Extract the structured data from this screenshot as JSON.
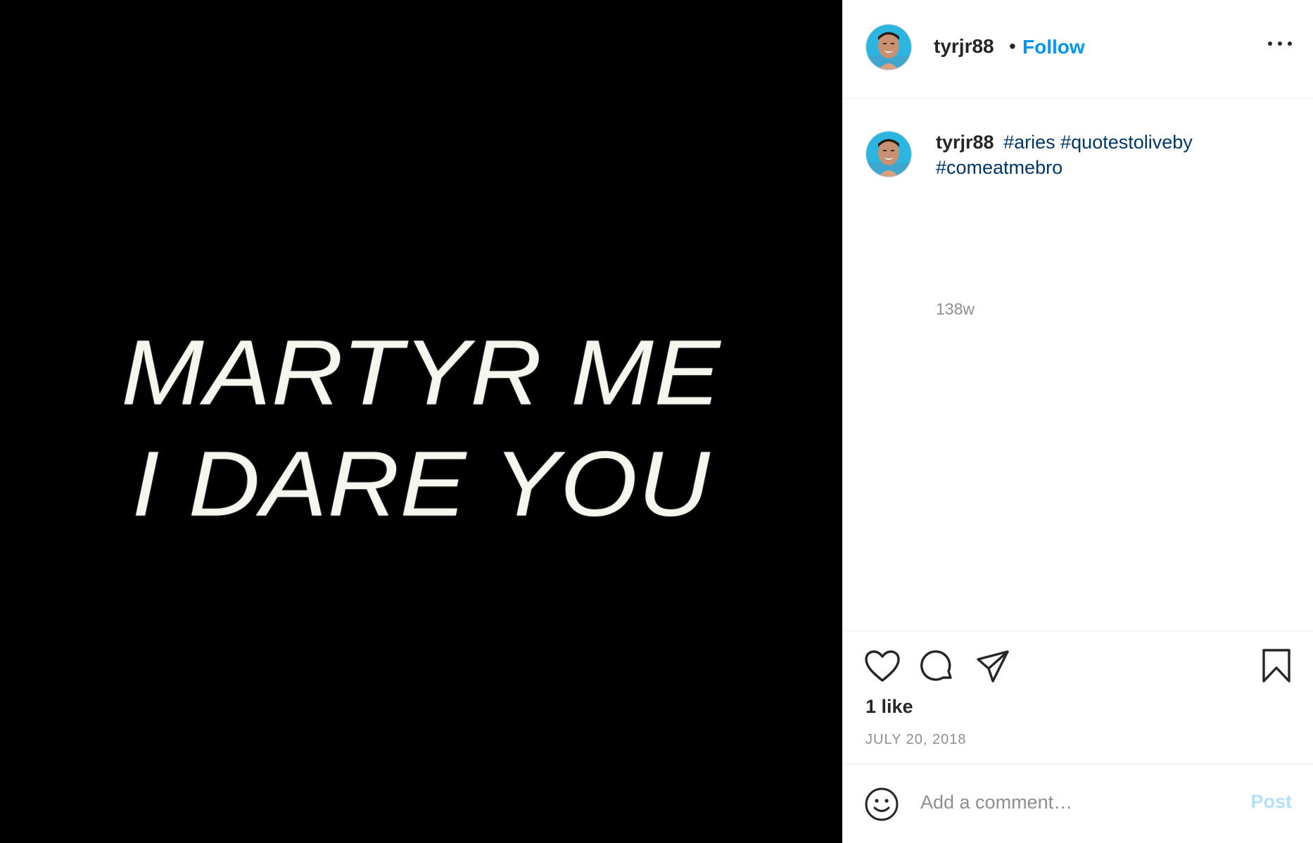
{
  "media": {
    "lines": [
      "MARTYR ME",
      "I DARE YOU"
    ]
  },
  "header": {
    "username": "tyrjr88",
    "separator": "•",
    "follow_label": "Follow",
    "more_icon": "more-horizontal-icon"
  },
  "caption": {
    "username": "tyrjr88",
    "hashtags": [
      "#aries",
      "#quotestoliveby",
      "#comeatmebro"
    ],
    "time": "138w"
  },
  "actions": {
    "icons": [
      "heart-icon",
      "comment-icon",
      "share-icon",
      "bookmark-icon"
    ],
    "likes": "1 like",
    "date": "JULY 20, 2018"
  },
  "comment": {
    "placeholder": "Add a comment…",
    "post_label": "Post",
    "emoji_icon": "emoji-icon"
  },
  "colors": {
    "accent": "#0095f6",
    "hashtag": "#00376b",
    "post_disabled": "#b2dffc",
    "text": "#262626",
    "muted": "#8e8e8e"
  }
}
